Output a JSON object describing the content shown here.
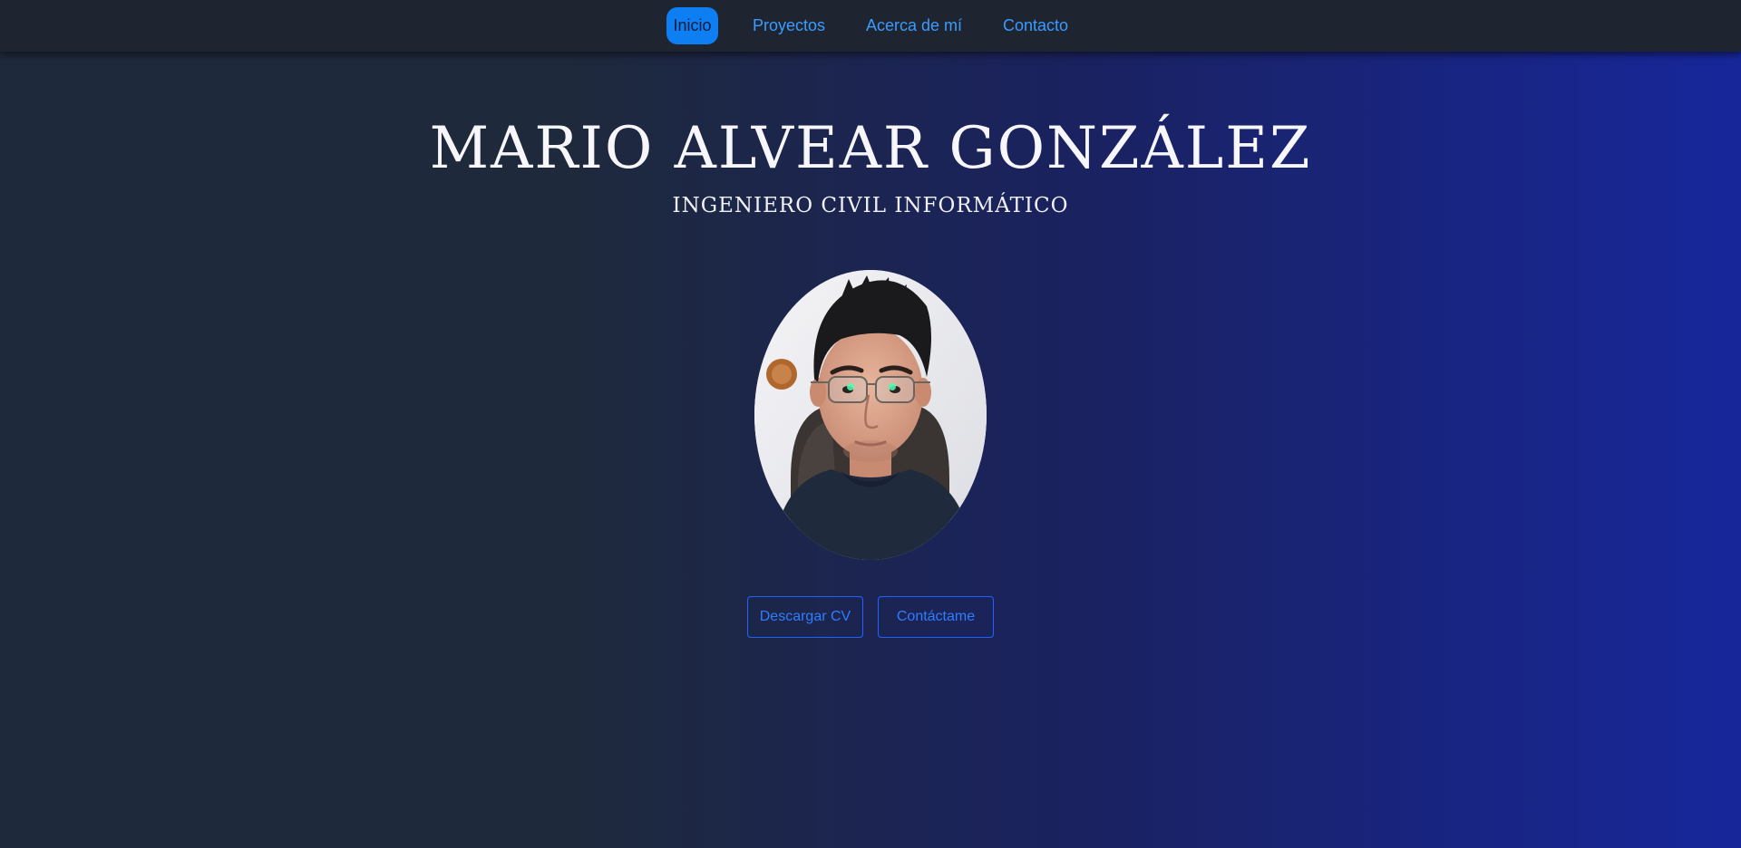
{
  "nav": {
    "items": [
      {
        "label": "Inicio",
        "active": true
      },
      {
        "label": "Proyectos",
        "active": false
      },
      {
        "label": "Acerca de mí",
        "active": false
      },
      {
        "label": "Contacto",
        "active": false
      }
    ]
  },
  "hero": {
    "name": "MARIO ALVEAR GONZÁLEZ",
    "title": "INGENIERO CIVIL INFORMÁTICO",
    "photo_alt": "profile-photo"
  },
  "actions": {
    "download_cv": "Descargar CV",
    "contact": "Contáctame"
  },
  "colors": {
    "nav_background": "#1e2531",
    "nav_link": "#3b9bff",
    "nav_active_background": "#0d7ff2",
    "gradient_left": "#1e293b",
    "gradient_right": "#17279b",
    "button_border": "#1f63ff"
  }
}
